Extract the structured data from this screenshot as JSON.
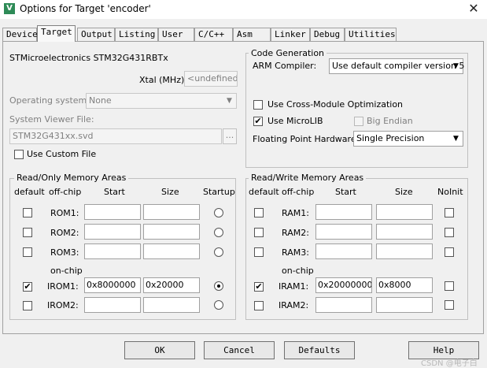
{
  "window": {
    "title": "Options for Target 'encoder'",
    "app_icon": "V",
    "close_glyph": "✕"
  },
  "tabs": [
    "Device",
    "Target",
    "Output",
    "Listing",
    "User",
    "C/C++",
    "Asm",
    "Linker",
    "Debug",
    "Utilities"
  ],
  "active_tab": "Target",
  "device_name": "STMicroelectronics STM32G431RBTx",
  "xtal": {
    "label": "Xtal (MHz):",
    "value": "<undefined>"
  },
  "os": {
    "label": "Operating system:",
    "value": "None"
  },
  "sysview": {
    "label": "System Viewer File:",
    "value": "STM32G431xx.svd",
    "browse": "..."
  },
  "use_custom_file": {
    "label": "Use Custom File",
    "checked": false
  },
  "code_gen": {
    "title": "Code Generation",
    "compiler_label": "ARM Compiler:",
    "compiler_value": "Use default compiler version 5",
    "cross_module": {
      "label": "Use Cross-Module Optimization",
      "checked": false
    },
    "microlib": {
      "label": "Use MicroLIB",
      "checked": true
    },
    "big_endian": {
      "label": "Big Endian",
      "checked": false
    },
    "fpu_label": "Floating Point Hardware:",
    "fpu_value": "Single Precision"
  },
  "ro_mem": {
    "title": "Read/Only Memory Areas",
    "headers": {
      "default": "default",
      "offchip": "off-chip",
      "start": "Start",
      "size": "Size",
      "last": "Startup"
    },
    "onchip_label": "on-chip",
    "rows": [
      {
        "name": "ROM1:",
        "default": false,
        "start": "",
        "size": "",
        "startup": false
      },
      {
        "name": "ROM2:",
        "default": false,
        "start": "",
        "size": "",
        "startup": false
      },
      {
        "name": "ROM3:",
        "default": false,
        "start": "",
        "size": "",
        "startup": false
      },
      {
        "name": "IROM1:",
        "default": true,
        "start": "0x8000000",
        "size": "0x20000",
        "startup": true
      },
      {
        "name": "IROM2:",
        "default": false,
        "start": "",
        "size": "",
        "startup": false
      }
    ]
  },
  "rw_mem": {
    "title": "Read/Write Memory Areas",
    "headers": {
      "default": "default",
      "offchip": "off-chip",
      "start": "Start",
      "size": "Size",
      "last": "NoInit"
    },
    "onchip_label": "on-chip",
    "rows": [
      {
        "name": "RAM1:",
        "default": false,
        "start": "",
        "size": "",
        "noinit": false
      },
      {
        "name": "RAM2:",
        "default": false,
        "start": "",
        "size": "",
        "noinit": false
      },
      {
        "name": "RAM3:",
        "default": false,
        "start": "",
        "size": "",
        "noinit": false
      },
      {
        "name": "IRAM1:",
        "default": true,
        "start": "0x20000000",
        "size": "0x8000",
        "noinit": false
      },
      {
        "name": "IRAM2:",
        "default": false,
        "start": "",
        "size": "",
        "noinit": false
      }
    ]
  },
  "buttons": {
    "ok": "OK",
    "cancel": "Cancel",
    "defaults": "Defaults",
    "help": "Help"
  },
  "watermark": "CSDN @电子白"
}
